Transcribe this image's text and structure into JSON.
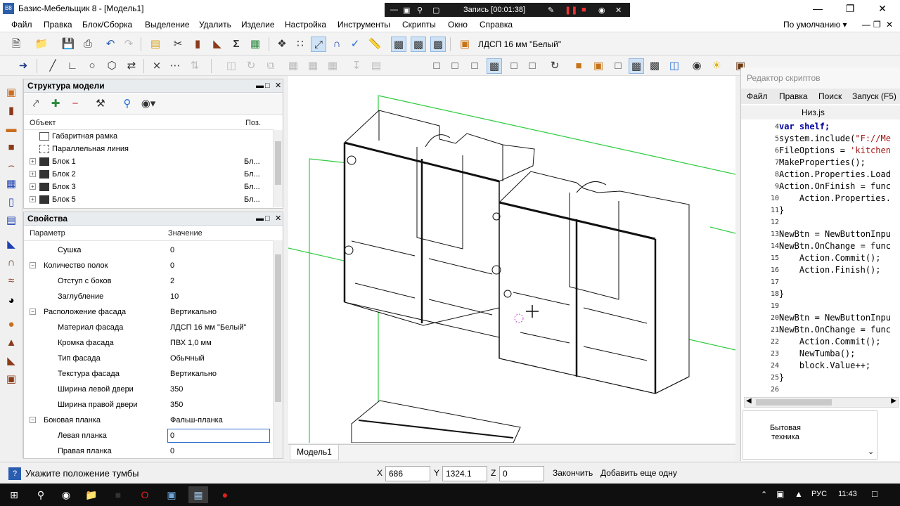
{
  "window": {
    "title": "Базис-Мебельщик 8 - [Модель1]",
    "app_icon": "app-icon-blue",
    "controls": [
      "minimize-icon",
      "restore-icon",
      "close-icon"
    ]
  },
  "recorder": {
    "label": "Запись [00:01:38]"
  },
  "menu": {
    "items": [
      "Файл",
      "Правка",
      "Блок/Сборка",
      "Выделение",
      "Удалить",
      "Изделие",
      "Настройка",
      "Инструменты",
      "Скрипты",
      "Окно",
      "Справка"
    ],
    "layout_preset": "По умолчанию"
  },
  "toolbar": {
    "material": "ЛДСП 16 мм \"Белый\""
  },
  "structure_panel": {
    "title": "Структура модели",
    "col_object": "Объект",
    "col_pos": "Поз.",
    "rows": [
      {
        "label": "Габаритная рамка",
        "pos": "",
        "expandable": false
      },
      {
        "label": "Параллельная линия",
        "pos": "",
        "expandable": false
      },
      {
        "label": "Блок 1",
        "pos": "Бл...",
        "expandable": true
      },
      {
        "label": "Блок 2",
        "pos": "Бл...",
        "expandable": true
      },
      {
        "label": "Блок 3",
        "pos": "Бл...",
        "expandable": true
      },
      {
        "label": "Блок 5",
        "pos": "Бл...",
        "expandable": true
      }
    ]
  },
  "properties_panel": {
    "title": "Свойства",
    "col_param": "Параметр",
    "col_value": "Значение",
    "rows": [
      {
        "name": "Сушка",
        "value": "0",
        "level": 1
      },
      {
        "name": "Количество полок",
        "value": "0",
        "level": 0
      },
      {
        "name": "Отступ с боков",
        "value": "2",
        "level": 1
      },
      {
        "name": "Заглубление",
        "value": "10",
        "level": 1
      },
      {
        "name": "Расположение фасада",
        "value": "Вертикально",
        "level": 0
      },
      {
        "name": "Материал фасада",
        "value": "ЛДСП 16 мм \"Белый\"",
        "level": 1
      },
      {
        "name": "Кромка фасада",
        "value": "ПВХ 1,0 мм",
        "level": 1
      },
      {
        "name": "Тип фасада",
        "value": "Обычный",
        "level": 1
      },
      {
        "name": "Текстура фасада",
        "value": "Вертикально",
        "level": 1
      },
      {
        "name": "Ширина левой двери",
        "value": "350",
        "level": 1
      },
      {
        "name": "Ширина правой двери",
        "value": "350",
        "level": 1
      },
      {
        "name": "Боковая планка",
        "value": "Фальш-планка",
        "level": 0
      },
      {
        "name": "Левая планка",
        "value": "0",
        "level": 1,
        "editing": true
      },
      {
        "name": "Правая планка",
        "value": "0",
        "level": 1
      }
    ]
  },
  "viewport": {
    "tab": "Модель1"
  },
  "script_editor": {
    "title": "Редактор скриптов",
    "menu": [
      "Файл",
      "Правка",
      "Поиск",
      "Запуск (F5)"
    ],
    "file_tab": "Низ.js",
    "lines": [
      {
        "n": "4",
        "text": "var shelf;"
      },
      {
        "n": "5",
        "text": "system.include(\"F://Me"
      },
      {
        "n": "6",
        "text": "FileOptions = 'kitchen"
      },
      {
        "n": "7",
        "text": "MakeProperties();"
      },
      {
        "n": "8",
        "text": "Action.Properties.Load"
      },
      {
        "n": "9",
        "text": "Action.OnFinish = func"
      },
      {
        "n": "10",
        "text": "    Action.Properties."
      },
      {
        "n": "11",
        "text": "}"
      },
      {
        "n": "12",
        "text": ""
      },
      {
        "n": "13",
        "text": "NewBtn = NewButtonInpu"
      },
      {
        "n": "14",
        "text": "NewBtn.OnChange = func"
      },
      {
        "n": "15",
        "text": "    Action.Commit();"
      },
      {
        "n": "16",
        "text": "    Action.Finish();"
      },
      {
        "n": "17",
        "text": ""
      },
      {
        "n": "18",
        "text": "}"
      },
      {
        "n": "19",
        "text": ""
      },
      {
        "n": "20",
        "text": "NewBtn = NewButtonInpu"
      },
      {
        "n": "21",
        "text": "NewBtn.OnChange = func"
      },
      {
        "n": "22",
        "text": "    Action.Commit();"
      },
      {
        "n": "23",
        "text": "    NewTumba();"
      },
      {
        "n": "24",
        "text": "    block.Value++;"
      },
      {
        "n": "25",
        "text": "}"
      },
      {
        "n": "26",
        "text": ""
      }
    ],
    "lower_item": "Бытовая техника"
  },
  "status": {
    "hint": "Укажите положение тумбы",
    "x_label": "X",
    "x_value": "686",
    "y_label": "Y",
    "y_value": "1324.1",
    "z_label": "Z",
    "z_value": "0",
    "finish": "Закончить",
    "add_more": "Добавить еще одну"
  },
  "taskbar": {
    "lang": "РУС",
    "time": "11:43",
    "icons": [
      "windows-icon",
      "search-icon",
      "app-icon",
      "folder-icon",
      "opera-icon",
      "monitor-icon",
      "basis-icon",
      "record-icon"
    ]
  },
  "colors": {
    "accent": "#2d5ea8",
    "grid_green": "#2ecc40",
    "keyword": "#0000a0",
    "string": "#a31515"
  }
}
